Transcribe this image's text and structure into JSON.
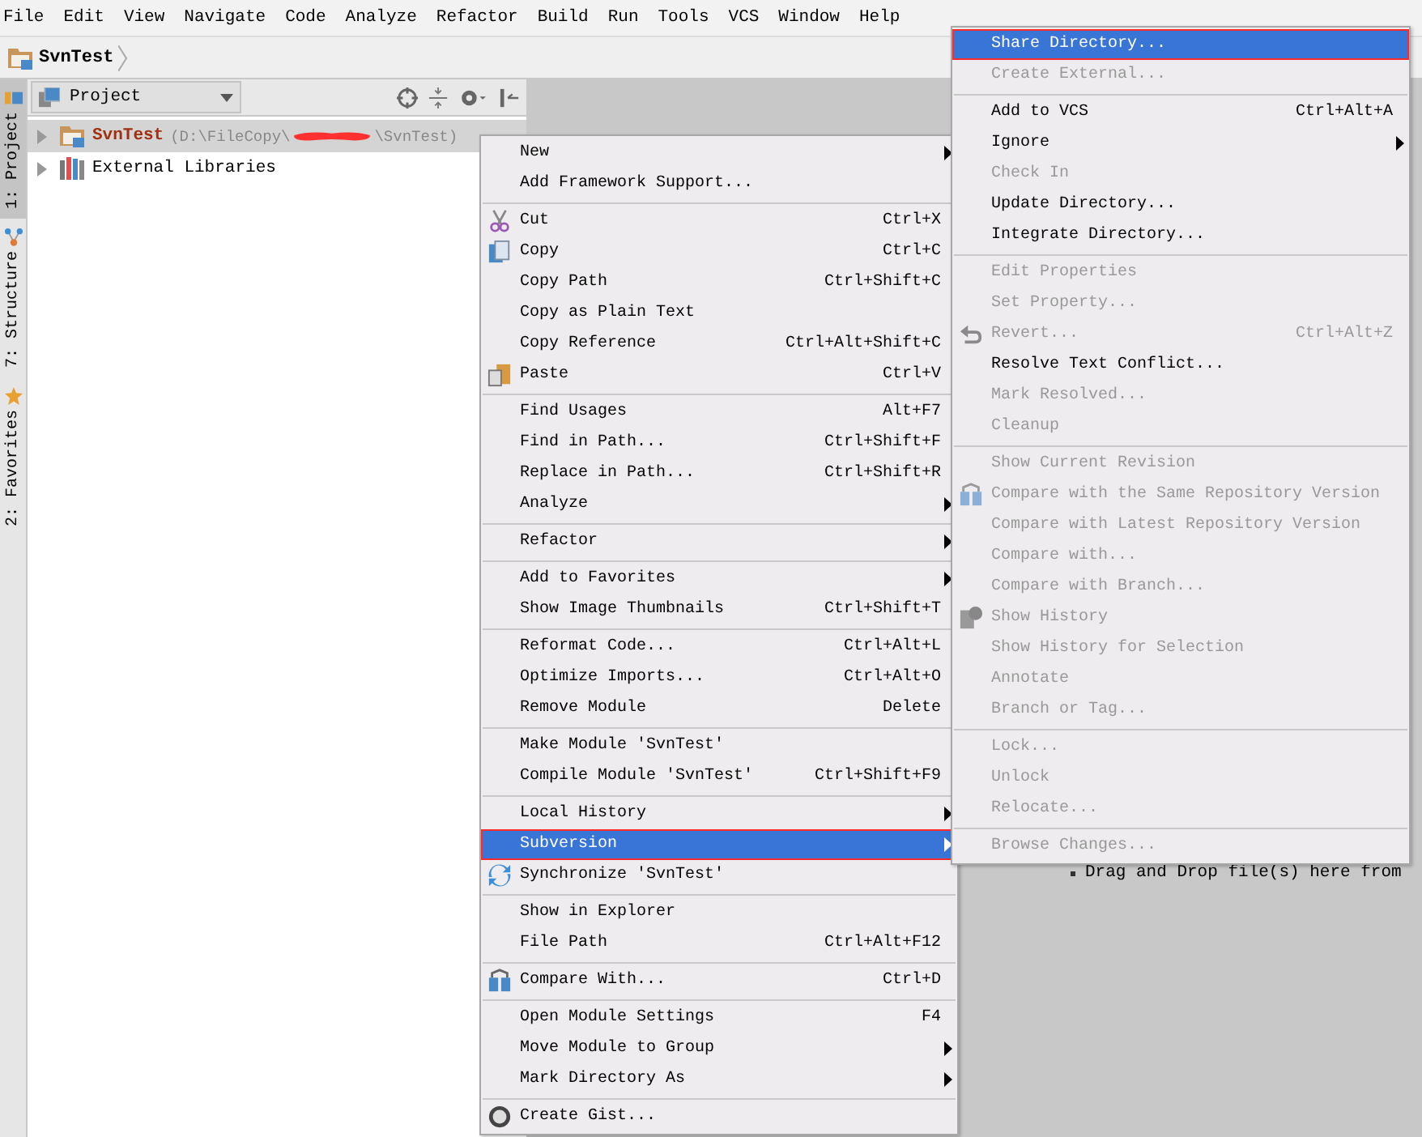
{
  "menu_bar": [
    "File",
    "Edit",
    "View",
    "Navigate",
    "Code",
    "Analyze",
    "Refactor",
    "Build",
    "Run",
    "Tools",
    "VCS",
    "Window",
    "Help"
  ],
  "breadcrumb": {
    "label": "SvnTest"
  },
  "tool_window_tabs": [
    {
      "label": "1: Project",
      "selected": true
    },
    {
      "label": "7: Structure",
      "selected": false
    },
    {
      "label": "2: Favorites",
      "selected": false
    }
  ],
  "project_panel": {
    "view_selector": "Project",
    "tree": [
      {
        "label": "SvnTest",
        "path_start": "(D:\\FileCopy\\",
        "path_end": "\\SvnTest)",
        "selected": true,
        "expanded": false
      },
      {
        "label": "External Libraries",
        "selected": false,
        "expanded": false
      }
    ]
  },
  "editor_hint": "Drag and Drop file(s) here from",
  "context_menu": {
    "items": [
      {
        "kind": "item",
        "label": "New",
        "submenu": true,
        "selected": false,
        "outlined": false
      },
      {
        "kind": "item",
        "label": "Add Framework Support...",
        "submenu": false,
        "selected": false,
        "outlined": false
      },
      {
        "kind": "separator"
      },
      {
        "kind": "item",
        "label": "Cut",
        "shortcut": "Ctrl+X",
        "submenu": false,
        "selected": false,
        "outlined": false
      },
      {
        "kind": "item",
        "label": "Copy",
        "shortcut": "Ctrl+C",
        "submenu": false,
        "selected": false,
        "outlined": false
      },
      {
        "kind": "item",
        "label": "Copy Path",
        "shortcut": "Ctrl+Shift+C",
        "submenu": false,
        "selected": false,
        "outlined": false
      },
      {
        "kind": "item",
        "label": "Copy as Plain Text",
        "submenu": false,
        "selected": false,
        "outlined": false
      },
      {
        "kind": "item",
        "label": "Copy Reference",
        "shortcut": "Ctrl+Alt+Shift+C",
        "submenu": false,
        "selected": false,
        "outlined": false
      },
      {
        "kind": "item",
        "label": "Paste",
        "shortcut": "Ctrl+V",
        "submenu": false,
        "selected": false,
        "outlined": false
      },
      {
        "kind": "separator"
      },
      {
        "kind": "item",
        "label": "Find Usages",
        "shortcut": "Alt+F7",
        "submenu": false,
        "selected": false,
        "outlined": false
      },
      {
        "kind": "item",
        "label": "Find in Path...",
        "shortcut": "Ctrl+Shift+F",
        "submenu": false,
        "selected": false,
        "outlined": false
      },
      {
        "kind": "item",
        "label": "Replace in Path...",
        "shortcut": "Ctrl+Shift+R",
        "submenu": false,
        "selected": false,
        "outlined": false
      },
      {
        "kind": "item",
        "label": "Analyze",
        "submenu": true,
        "selected": false,
        "outlined": false
      },
      {
        "kind": "separator"
      },
      {
        "kind": "item",
        "label": "Refactor",
        "submenu": true,
        "selected": false,
        "outlined": false
      },
      {
        "kind": "separator"
      },
      {
        "kind": "item",
        "label": "Add to Favorites",
        "submenu": true,
        "selected": false,
        "outlined": false
      },
      {
        "kind": "item",
        "label": "Show Image Thumbnails",
        "shortcut": "Ctrl+Shift+T",
        "submenu": false,
        "selected": false,
        "outlined": false
      },
      {
        "kind": "separator"
      },
      {
        "kind": "item",
        "label": "Reformat Code...",
        "shortcut": "Ctrl+Alt+L",
        "submenu": false,
        "selected": false,
        "outlined": false
      },
      {
        "kind": "item",
        "label": "Optimize Imports...",
        "shortcut": "Ctrl+Alt+O",
        "submenu": false,
        "selected": false,
        "outlined": false
      },
      {
        "kind": "item",
        "label": "Remove Module",
        "shortcut": "Delete",
        "submenu": false,
        "selected": false,
        "outlined": false
      },
      {
        "kind": "separator"
      },
      {
        "kind": "item",
        "label": "Make Module 'SvnTest'",
        "submenu": false,
        "selected": false,
        "outlined": false
      },
      {
        "kind": "item",
        "label": "Compile Module 'SvnTest'",
        "shortcut": "Ctrl+Shift+F9",
        "submenu": false,
        "selected": false,
        "outlined": false
      },
      {
        "kind": "separator"
      },
      {
        "kind": "item",
        "label": "Local History",
        "submenu": true,
        "selected": false,
        "outlined": false
      },
      {
        "kind": "item",
        "label": "Subversion",
        "submenu": true,
        "selected": true,
        "outlined": true
      },
      {
        "kind": "item",
        "label": "Synchronize 'SvnTest'",
        "submenu": false,
        "selected": false,
        "outlined": false
      },
      {
        "kind": "separator"
      },
      {
        "kind": "item",
        "label": "Show in Explorer",
        "submenu": false,
        "selected": false,
        "outlined": false
      },
      {
        "kind": "item",
        "label": "File Path",
        "shortcut": "Ctrl+Alt+F12",
        "submenu": false,
        "selected": false,
        "outlined": false
      },
      {
        "kind": "separator"
      },
      {
        "kind": "item",
        "label": "Compare With...",
        "shortcut": "Ctrl+D",
        "submenu": false,
        "selected": false,
        "outlined": false
      },
      {
        "kind": "separator"
      },
      {
        "kind": "item",
        "label": "Open Module Settings",
        "shortcut": "F4",
        "submenu": false,
        "selected": false,
        "outlined": false
      },
      {
        "kind": "item",
        "label": "Move Module to Group",
        "submenu": true,
        "selected": false,
        "outlined": false
      },
      {
        "kind": "item",
        "label": "Mark Directory As",
        "submenu": true,
        "selected": false,
        "outlined": false
      },
      {
        "kind": "separator"
      },
      {
        "kind": "item",
        "label": "Create Gist...",
        "submenu": false,
        "selected": false,
        "outlined": false
      }
    ]
  },
  "subversion_menu": {
    "items": [
      {
        "kind": "item",
        "label": "Share Directory...",
        "submenu": false,
        "disabled": false,
        "selected": true,
        "outlined": true
      },
      {
        "kind": "item",
        "label": "Create External...",
        "submenu": false,
        "disabled": true,
        "selected": false,
        "outlined": false
      },
      {
        "kind": "separator"
      },
      {
        "kind": "item",
        "label": "Add to VCS",
        "shortcut": "Ctrl+Alt+A",
        "submenu": false,
        "disabled": false,
        "selected": false,
        "outlined": false
      },
      {
        "kind": "item",
        "label": "Ignore",
        "submenu": true,
        "disabled": false,
        "selected": false,
        "outlined": false
      },
      {
        "kind": "item",
        "label": "Check In",
        "submenu": false,
        "disabled": true,
        "selected": false,
        "outlined": false
      },
      {
        "kind": "item",
        "label": "Update Directory...",
        "submenu": false,
        "disabled": false,
        "selected": false,
        "outlined": false
      },
      {
        "kind": "item",
        "label": "Integrate Directory...",
        "submenu": false,
        "disabled": false,
        "selected": false,
        "outlined": false
      },
      {
        "kind": "separator"
      },
      {
        "kind": "item",
        "label": "Edit Properties",
        "submenu": false,
        "disabled": true,
        "selected": false,
        "outlined": false
      },
      {
        "kind": "item",
        "label": "Set Property...",
        "submenu": false,
        "disabled": true,
        "selected": false,
        "outlined": false
      },
      {
        "kind": "item",
        "label": "Revert...",
        "shortcut": "Ctrl+Alt+Z",
        "submenu": false,
        "disabled": true,
        "selected": false,
        "outlined": false
      },
      {
        "kind": "item",
        "label": "Resolve Text Conflict...",
        "submenu": false,
        "disabled": false,
        "selected": false,
        "outlined": false
      },
      {
        "kind": "item",
        "label": "Mark Resolved...",
        "submenu": false,
        "disabled": true,
        "selected": false,
        "outlined": false
      },
      {
        "kind": "item",
        "label": "Cleanup",
        "submenu": false,
        "disabled": true,
        "selected": false,
        "outlined": false
      },
      {
        "kind": "separator"
      },
      {
        "kind": "item",
        "label": "Show Current Revision",
        "submenu": false,
        "disabled": true,
        "selected": false,
        "outlined": false
      },
      {
        "kind": "item",
        "label": "Compare with the Same Repository Version",
        "submenu": false,
        "disabled": true,
        "selected": false,
        "outlined": false
      },
      {
        "kind": "item",
        "label": "Compare with Latest Repository Version",
        "submenu": false,
        "disabled": true,
        "selected": false,
        "outlined": false
      },
      {
        "kind": "item",
        "label": "Compare with...",
        "submenu": false,
        "disabled": true,
        "selected": false,
        "outlined": false
      },
      {
        "kind": "item",
        "label": "Compare with Branch...",
        "submenu": false,
        "disabled": true,
        "selected": false,
        "outlined": false
      },
      {
        "kind": "item",
        "label": "Show History",
        "submenu": false,
        "disabled": true,
        "selected": false,
        "outlined": false
      },
      {
        "kind": "item",
        "label": "Show History for Selection",
        "submenu": false,
        "disabled": true,
        "selected": false,
        "outlined": false
      },
      {
        "kind": "item",
        "label": "Annotate",
        "submenu": false,
        "disabled": true,
        "selected": false,
        "outlined": false
      },
      {
        "kind": "item",
        "label": "Branch or Tag...",
        "submenu": false,
        "disabled": true,
        "selected": false,
        "outlined": false
      },
      {
        "kind": "separator"
      },
      {
        "kind": "item",
        "label": "Lock...",
        "submenu": false,
        "disabled": true,
        "selected": false,
        "outlined": false
      },
      {
        "kind": "item",
        "label": "Unlock",
        "submenu": false,
        "disabled": true,
        "selected": false,
        "outlined": false
      },
      {
        "kind": "item",
        "label": "Relocate...",
        "submenu": false,
        "disabled": true,
        "selected": false,
        "outlined": false
      },
      {
        "kind": "separator"
      },
      {
        "kind": "item",
        "label": "Browse Changes...",
        "submenu": false,
        "disabled": true,
        "selected": false,
        "outlined": false
      }
    ]
  }
}
